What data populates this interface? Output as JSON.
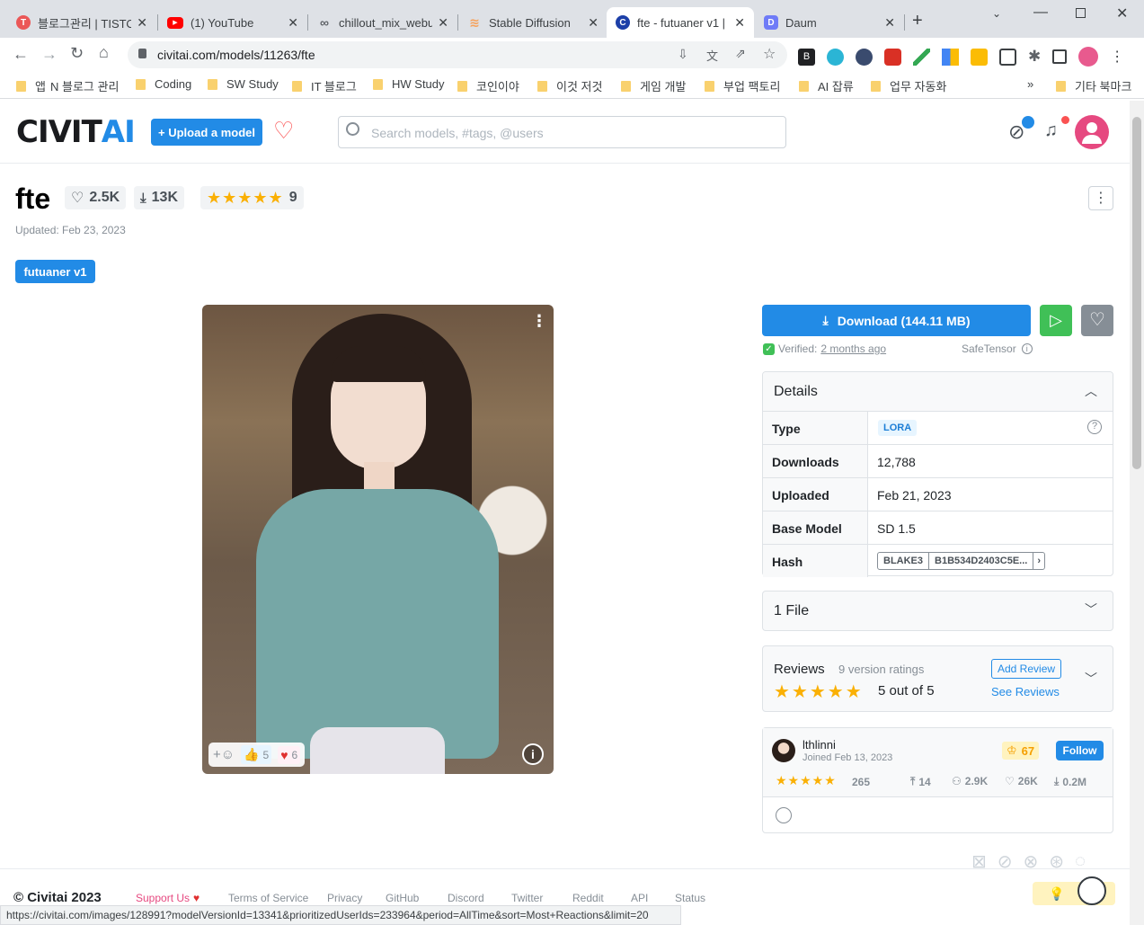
{
  "browser": {
    "tabs": [
      {
        "title": "블로그관리 | TISTO",
        "color": "#eb5757",
        "icon": "T"
      },
      {
        "title": "(1) YouTube",
        "color": "#ff0000",
        "icon": "▶"
      },
      {
        "title": "chillout_mix_webui",
        "color": "#5f6368",
        "icon": "∞"
      },
      {
        "title": "Stable Diffusion",
        "color": "#f6a15b",
        "icon": "≋"
      },
      {
        "title": "fte - futuaner v1 |",
        "color": "#1c3fa8",
        "icon": "C"
      },
      {
        "title": "Daum",
        "color": "#6f7bf7",
        "icon": "D"
      }
    ],
    "url": "civitai.com/models/11263/fte",
    "bookmarks": [
      "앱",
      "N 블로그 관리",
      "Coding",
      "SW Study",
      "IT 블로그",
      "HW Study",
      "코인이야",
      "이것 저것",
      "게임 개발",
      "부업 팩토리",
      "AI 잡류",
      "업무 자동화",
      "기타 북마크"
    ],
    "status_url": "https://civitai.com/images/128991?modelVersionId=13341&prioritizedUserIds=233964&period=AllTime&sort=Most+Reactions&limit=20"
  },
  "header": {
    "logo_left": "CIVIT",
    "logo_right": "AI",
    "upload_label": "+ Upload a model",
    "search_placeholder": "Search models, #tags, @users"
  },
  "model": {
    "name": "fte",
    "likes": "2.5K",
    "downloads": "13K",
    "rating_count": "9",
    "updated": "Updated: Feb 23, 2023",
    "version_badge": "futuaner v1"
  },
  "image": {
    "reaction_like": "5",
    "reaction_heart": "6"
  },
  "download": {
    "label": "Download (144.11 MB)",
    "verified_prefix": "Verified:",
    "verified_link": "2 months ago",
    "format": "SafeTensor"
  },
  "details": {
    "title": "Details",
    "rows": [
      {
        "key": "Type",
        "value": "LORA"
      },
      {
        "key": "Downloads",
        "value": "12,788"
      },
      {
        "key": "Uploaded",
        "value": "Feb 21, 2023"
      },
      {
        "key": "Base Model",
        "value": "SD 1.5"
      },
      {
        "key": "Hash",
        "value": "B1B534D2403C5E..."
      }
    ],
    "hash_algo": "BLAKE3"
  },
  "files": {
    "title": "1 File"
  },
  "reviews": {
    "title": "Reviews",
    "ratings_label": "9 version ratings",
    "add_label": "Add Review",
    "score_label": "5 out of 5",
    "see_label": "See Reviews"
  },
  "creator": {
    "name": "lthlinni",
    "joined": "Joined Feb 13, 2023",
    "rank": "67",
    "follow_label": "Follow",
    "review_count": "265",
    "uploads": "14",
    "followers": "2.9K",
    "favorites": "26K",
    "downloads": "0.2M"
  },
  "footer": {
    "copyright": "© Civitai 2023",
    "support": "Support Us",
    "links": [
      "Terms of Service",
      "Privacy",
      "GitHub",
      "Discord",
      "Twitter",
      "Reddit",
      "API",
      "Status"
    ]
  }
}
